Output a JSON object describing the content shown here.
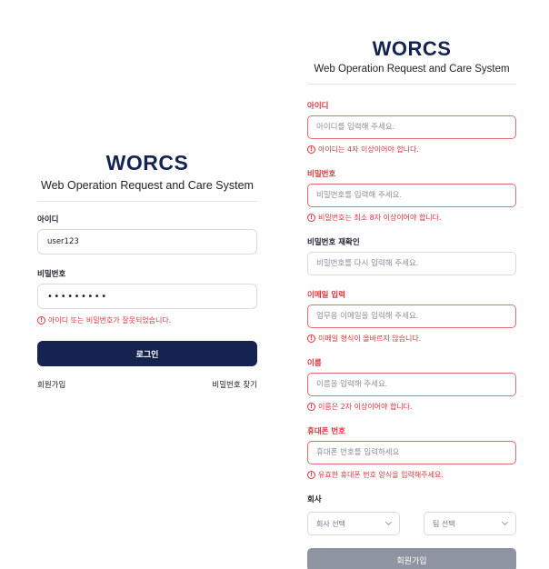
{
  "brand": {
    "name": "WORCS",
    "subtitle": "Web Operation Request and Care System"
  },
  "login": {
    "id_label": "아이디",
    "id_value": "user123",
    "pw_label": "비밀번호",
    "pw_value": "password1",
    "error": "아이디 또는 비밀번호가 잘못되었습니다.",
    "submit_label": "로그인",
    "signup_link": "회원가입",
    "find_pw_link": "비밀번호 찾기"
  },
  "signup": {
    "fields": [
      {
        "label": "아이디",
        "placeholder": "아이디를 입력해 주세요.",
        "error": "아이디는 4자 이상이어야 합니다."
      },
      {
        "label": "비밀번호",
        "placeholder": "비밀번호를 입력해 주세요.",
        "error": "비밀번호는 최소 8자 이상이어야 합니다."
      },
      {
        "label": "비밀번호 재확인",
        "placeholder": "비밀번호를 다시 입력해 주세요."
      },
      {
        "label": "이메일 입력",
        "placeholder": "업무용 이메일을 입력해 주세요.",
        "error": "이메일 형식이 올바르지 않습니다."
      },
      {
        "label": "이름",
        "placeholder": "이름을 입력해 주세요.",
        "error": "이름은 2자 이상이어야 합니다."
      },
      {
        "label": "휴대폰 번호",
        "placeholder": "휴대폰 번호를 입력하세요",
        "error": "유효한 휴대폰 번호 양식을 입력해주세요."
      }
    ],
    "company_label": "회사",
    "company_select": "회사 선택",
    "team_select": "팀 선택",
    "submit_label": "회원가입"
  },
  "colors": {
    "brand_navy": "#14234f",
    "error_red": "#e0323c",
    "disabled_button": "#8f94a3"
  },
  "icons": [
    "error-circle-icon",
    "chevron-down-icon"
  ]
}
